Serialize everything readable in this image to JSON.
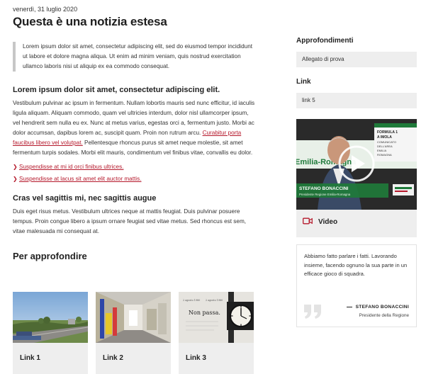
{
  "article": {
    "date": "venerdì, 31 luglio 2020",
    "title": "Questa è una notizia estesa",
    "quote": "Lorem ipsum dolor sit amet, consectetur adipiscing elit, sed do eiusmod tempor incididunt ut labore et dolore magna aliqua. Ut enim ad minim veniam, quis nostrud exercitation ullamco laboris nisi ut aliquip ex ea commodo consequat.",
    "heading1": "Lorem ipsum dolor sit amet, consectetur adipiscing elit.",
    "para1_before": "Vestibulum pulvinar ac ipsum in fermentum. Nullam lobortis mauris sed nunc efficitur, id iaculis ligula aliquam. Aliquam commodo, quam vel ultricies interdum, dolor nisl ullamcorper ipsum, vel hendrerit sem nulla eu ex. Nunc at metus varius, egestas orci a, fermentum justo. Morbi ac dolor accumsan, dapibus lorem ac, suscipit quam. Proin non rutrum arcu. ",
    "para1_link": "Curabitur porta faucibus libero vel volutpat.",
    "para1_after": " Pellentesque rhoncus purus sit amet neque molestie, sit amet fermentum turpis sodales. Morbi elit mauris, condimentum vel finibus vitae, convallis eu dolor.",
    "list_links": [
      "Suspendisse at mi id orci finibus ultrices.",
      "Suspendisse at lacus sit amet elit auctor mattis."
    ],
    "heading2": "Cras vel sagittis mi, nec sagittis augue",
    "para2": "Duis eget risus metus. Vestibulum ultrices neque at mattis feugiat. Duis pulvinar posuere tempus. Proin congue libero a ipsum ornare feugiat sed vitae metus. Sed rhoncus est sem, vitae malesuada mi consequat at.",
    "heading3": "Per approfondire"
  },
  "cards": [
    {
      "label": "Link 1",
      "image": "road-landscape"
    },
    {
      "label": "Link 2",
      "image": "corridor-interior"
    },
    {
      "label": "Link 3",
      "image": "clock-book-page",
      "image_text": {
        "line1": "2 agosto 1980",
        "line2": "2 agosto 1980",
        "title": "Non passa."
      }
    }
  ],
  "sidebar": {
    "approfondimenti_title": "Approfondimenti",
    "approfondimenti_item": "Allegato di prova",
    "link_title": "Link",
    "link_item": "link 5",
    "video": {
      "label": "Video",
      "icon": "video-camera-icon",
      "overlay_name": "STEFANO BONACCINI",
      "overlay_role": "Presidente Regione Emilia-Romagna",
      "banner_text": "Emilia-Romagna",
      "sign_text": "FORMULA 1 A IMOLA COMUNICATO DELL'AREA EMILIA ROMAGNA"
    },
    "testimonial": {
      "quote": "Abbiamo fatto parlare i fatti. Lavorando insieme, facendo ognuno la sua parte in un efficace gioco di squadra.",
      "author": "STEFANO BONACCINI",
      "role": "Presidente della Regione"
    }
  },
  "colors": {
    "accent": "#b5182b",
    "panel": "#eeeeee",
    "quote_border": "#c7c7c7"
  }
}
